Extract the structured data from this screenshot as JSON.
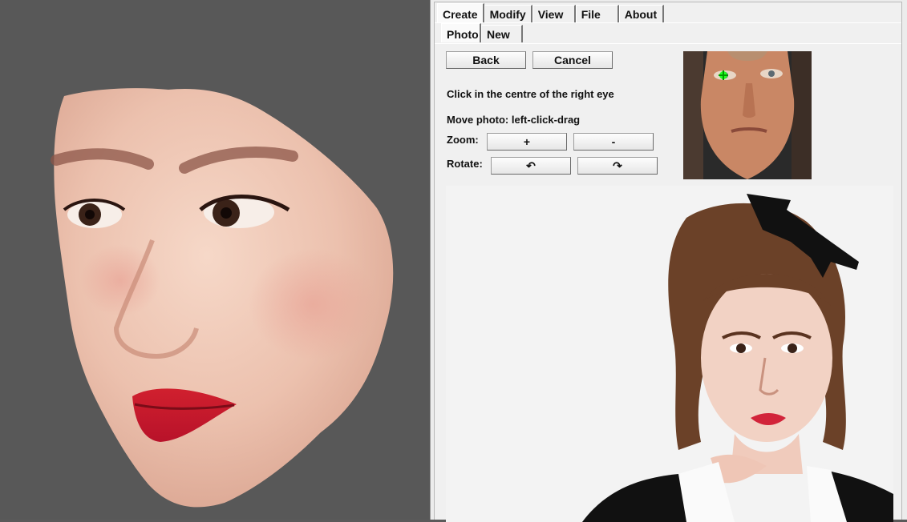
{
  "main_tabs": [
    "Create",
    "Modify",
    "View",
    "File",
    "About"
  ],
  "sub_tabs": [
    "Photo",
    "New"
  ],
  "buttons": {
    "back": "Back",
    "cancel": "Cancel"
  },
  "instruction": "Click in the centre of the right eye",
  "move_hint": "Move photo: left-click-drag",
  "zoom": {
    "label": "Zoom:",
    "in": "+",
    "out": "-"
  },
  "rotate": {
    "label": "Rotate:",
    "ccw": "↶",
    "cw": "↷"
  },
  "colors": {
    "viewport_bg": "#585858",
    "panel_bg": "#f0f0f0",
    "eye_marker": "#22ff22"
  }
}
